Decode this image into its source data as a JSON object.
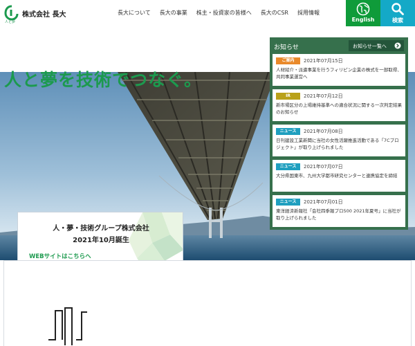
{
  "header": {
    "logo_company": "株式会社 長大",
    "logo_tagline": "人と夢",
    "nav": [
      "長大について",
      "長大の事業",
      "株主・投資家の皆様へ",
      "長大のCSR",
      "採用情報"
    ],
    "english_label": "English",
    "search_label": "検索"
  },
  "hero": {
    "catchphrase": "人と夢を技術でつなぐ。",
    "banner": {
      "line1": "人・夢・技術グループ株式会社",
      "line2": "2021年10月誕生",
      "link": "WEBサイトはこちらへ"
    }
  },
  "news": {
    "title": "お知らせ",
    "all_label": "お知らせ一覧へ",
    "items": [
      {
        "badge": "ご案内",
        "badge_color": "#e9892a",
        "date": "2021年07月15日",
        "text": "人材紹介・派遣事業を行うフィリピン企業の株式を一部取得、共同事業運営へ"
      },
      {
        "badge": "IR",
        "badge_color": "#b9a11a",
        "date": "2021年07月12日",
        "text": "新市場区分の上場維持基準への適合状況に関する一次判定結果のお知らせ"
      },
      {
        "badge": "ニュース",
        "badge_color": "#1f9fbf",
        "date": "2021年07月08日",
        "text": "日刊建設工業新聞に当社の女性活躍推進活動である「7Cプロジェクト」が取り上げられました"
      },
      {
        "badge": "ニュース",
        "badge_color": "#1f9fbf",
        "date": "2021年07月07日",
        "text": "大分県国東市、九州大学都市研究センターと連携協定を締結"
      },
      {
        "badge": "ニュース",
        "badge_color": "#1f9fbf",
        "date": "2021年07月01日",
        "text": "東洋経済新報社「会社四季報プロ500 2021年夏号」に当社が取り上げられました"
      }
    ]
  },
  "colors": {
    "brand_green": "#1c9a4e",
    "english_button": "#0f9b3a",
    "search_button": "#14a9c7",
    "news_panel": "#36704c"
  }
}
